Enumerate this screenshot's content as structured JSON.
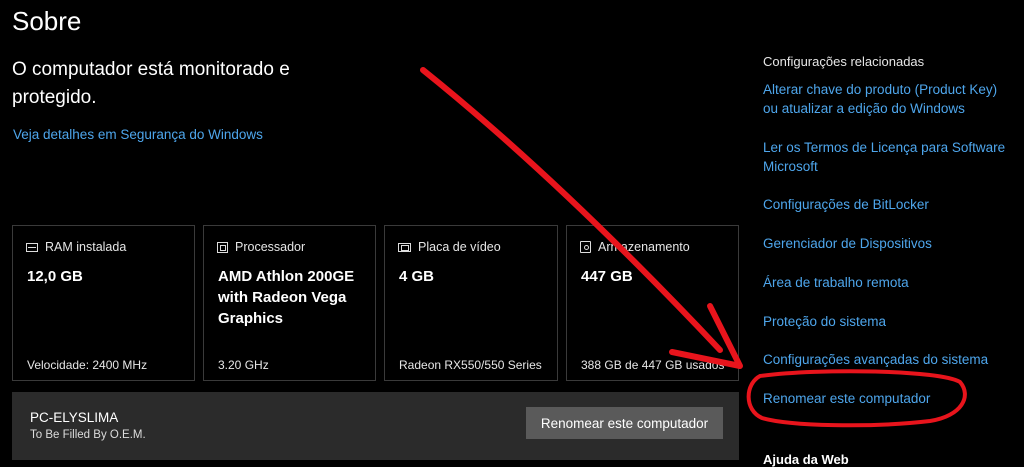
{
  "page": {
    "title": "Sobre",
    "status": "O computador está monitorado e protegido.",
    "security_link": "Veja detalhes em Segurança do Windows"
  },
  "specs": [
    {
      "label": "RAM instalada",
      "icon": "memory-icon",
      "value": "12,0 GB",
      "detail": "Velocidade: 2400 MHz"
    },
    {
      "label": "Processador",
      "icon": "processor-icon",
      "value": "AMD Athlon 200GE with Radeon Vega Graphics",
      "detail": "3.20 GHz"
    },
    {
      "label": "Placa de vídeo",
      "icon": "graphics-card-icon",
      "value": "4 GB",
      "detail": "Radeon RX550/550 Series"
    },
    {
      "label": "Armazenamento",
      "icon": "storage-icon",
      "value": "447 GB",
      "detail": "388 GB de 447 GB usados"
    }
  ],
  "device": {
    "name": "PC-ELYSLIMA",
    "manufacturer": "To Be Filled By O.E.M.",
    "rename_button": "Renomear este computador"
  },
  "related": {
    "title": "Configurações relacionadas",
    "links": [
      "Alterar chave do produto (Product Key) ou atualizar a edição do Windows",
      "Ler os Termos de Licença para Software Microsoft",
      "Configurações de BitLocker",
      "Gerenciador de Dispositivos",
      "Área de trabalho remota",
      "Proteção do sistema",
      "Configurações avançadas do sistema",
      "Renomear este computador"
    ],
    "next_heading_partial": "Ajuda da Web"
  },
  "annotations": {
    "color": "#e8141c"
  }
}
